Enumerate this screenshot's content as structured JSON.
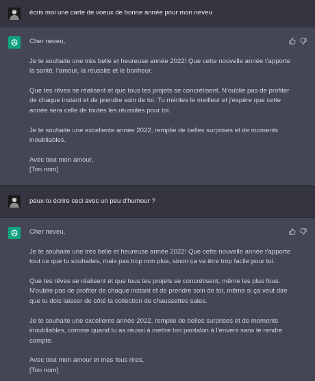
{
  "colors": {
    "user_bg": "#343541",
    "assistant_bg": "#444654",
    "text": "#d1d5db",
    "accent": "#10a37f"
  },
  "icons": {
    "user_avatar": "user-avatar",
    "assistant_avatar": "openai-logo-icon",
    "like": "thumbs-up-icon",
    "dislike": "thumbs-down-icon"
  },
  "conversation": [
    {
      "role": "user",
      "text": "écris moi une carte de voeux de bonne année pour mon neveu"
    },
    {
      "role": "assistant",
      "paragraphs": [
        "Cher neveu,",
        "Je te souhaite une très belle et heureuse année 2022! Que cette nouvelle année t'apporte la santé, l'amour, la réussite et le bonheur.",
        "Que tes rêves se réalisent et que tous tes projets se concrétisent. N'oublie pas de profiter de chaque instant et de prendre soin de toi. Tu mérites le meilleur et j'espère que cette année sera celle de toutes les réussites pour toi.",
        "Je te souhaite une excellente année 2022, remplie de belles surprises et de moments inoubliables.",
        "Avec tout mon amour,",
        "[Ton nom]"
      ]
    },
    {
      "role": "user",
      "text": "peux-tu écrire ceci avec un peu d'humour ?"
    },
    {
      "role": "assistant",
      "paragraphs": [
        "Cher neveu,",
        "Je te souhaite une très belle et heureuse année 2022! Que cette nouvelle année t'apporte tout ce que tu souhaites, mais pas trop non plus, sinon ça va être trop facile pour toi.",
        "Que tes rêves se réalisent et que tous tes projets se concrétisent, même les plus fous. N'oublie pas de profiter de chaque instant et de prendre soin de toi, même si ça veut dire que tu dois laisser de côté ta collection de chaussettes sales.",
        "Je te souhaite une excellente année 2022, remplie de belles surprises et de moments inoubliables, comme quand tu as réussi à mettre ton pantalon à l'envers sans te rendre compte.",
        "Avec tout mon amour et mes fous rires,",
        "[Ton nom]"
      ]
    }
  ]
}
